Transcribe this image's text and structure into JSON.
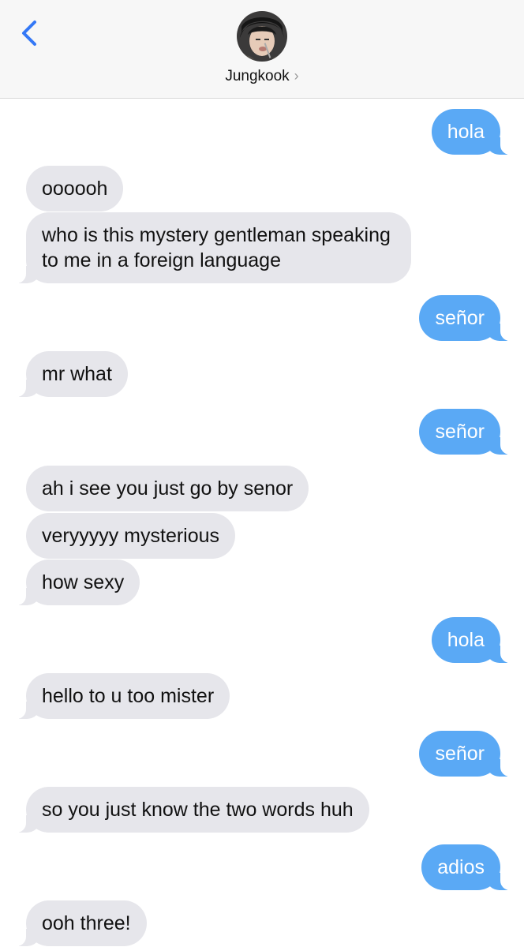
{
  "header": {
    "contact_name": "Jungkook",
    "chevron": "›",
    "back_icon": "chevron-left-icon",
    "accent_color": "#3478f6"
  },
  "colors": {
    "outgoing_bubble": "#5aa9f5",
    "incoming_bubble": "#e6e6eb"
  },
  "messages": [
    {
      "from": "me",
      "text": "hola"
    },
    {
      "from": "them",
      "text": "oooooh"
    },
    {
      "from": "them",
      "text": "who is this mystery gentleman speaking to me in a foreign language"
    },
    {
      "from": "me",
      "text": "señor"
    },
    {
      "from": "them",
      "text": "mr what"
    },
    {
      "from": "me",
      "text": "señor"
    },
    {
      "from": "them",
      "text": "ah i see you just go by senor"
    },
    {
      "from": "them",
      "text": "veryyyyy mysterious"
    },
    {
      "from": "them",
      "text": "how sexy"
    },
    {
      "from": "me",
      "text": "hola"
    },
    {
      "from": "them",
      "text": "hello to u too mister"
    },
    {
      "from": "me",
      "text": "señor"
    },
    {
      "from": "them",
      "text": "so you just know the two words huh"
    },
    {
      "from": "me",
      "text": "adios"
    },
    {
      "from": "them",
      "text": "ooh three!"
    }
  ]
}
